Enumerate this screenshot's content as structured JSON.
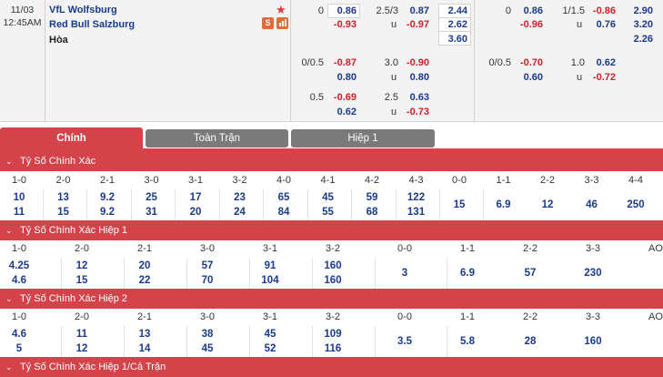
{
  "match": {
    "date": "11/03",
    "time": "12:45AM",
    "home_team": "VfL Wolfsburg",
    "away_team": "Red Bull Salzburg",
    "draw_label": "Hòa",
    "badge_s": "S"
  },
  "odds": {
    "block1": {
      "r1": {
        "hc": "0",
        "v1": "0.86",
        "ou": "2.5/3",
        "v2": "0.87",
        "x12": "2.44"
      },
      "r2": {
        "v1": "-0.93",
        "u": "u",
        "v2": "-0.97",
        "x12": "2.62"
      },
      "r3": {
        "x12": "3.60"
      }
    },
    "block2": {
      "r1": {
        "hc": "0/0.5",
        "v1": "-0.87",
        "ou": "3.0",
        "v2": "-0.90"
      },
      "r2": {
        "v1": "0.80",
        "u": "u",
        "v2": "0.80"
      }
    },
    "block3": {
      "r1": {
        "hc": "0.5",
        "v1": "-0.69",
        "ou": "2.5",
        "v2": "0.63"
      },
      "r2": {
        "v1": "0.62",
        "u": "u",
        "v2": "-0.73"
      }
    },
    "half1": {
      "r1": {
        "hc": "0",
        "v1": "0.86",
        "ou": "1/1.5",
        "v2": "-0.86",
        "x12": "2.90"
      },
      "r2": {
        "v1": "-0.96",
        "u": "u",
        "v2": "0.76",
        "x12": "3.20"
      },
      "r3": {
        "x12": "2.26"
      }
    },
    "half2": {
      "r1": {
        "hc": "0/0.5",
        "v1": "-0.70",
        "ou": "1.0",
        "v2": "0.62"
      },
      "r2": {
        "v1": "0.60",
        "u": "u",
        "v2": "-0.72"
      }
    }
  },
  "tabs": {
    "main": "Chính",
    "full": "Toàn Trận",
    "half": "Hiệp 1"
  },
  "sections": {
    "s1": {
      "title": "Tỷ Số Chính Xác",
      "headers": [
        "1-0",
        "2-0",
        "2-1",
        "3-0",
        "3-1",
        "3-2",
        "4-0",
        "4-1",
        "4-2",
        "4-3",
        "0-0",
        "1-1",
        "2-2",
        "3-3",
        "4-4"
      ],
      "home": [
        "10",
        "13",
        "9.2",
        "25",
        "17",
        "23",
        "65",
        "45",
        "59",
        "122"
      ],
      "away": [
        "11",
        "15",
        "9.2",
        "31",
        "20",
        "24",
        "84",
        "55",
        "68",
        "131"
      ],
      "draw": [
        "15",
        "6.9",
        "12",
        "46",
        "250"
      ]
    },
    "s2": {
      "title": "Tỷ Số Chính Xác Hiệp 1",
      "headers": [
        "1-0",
        "2-0",
        "2-1",
        "3-0",
        "3-1",
        "3-2",
        "0-0",
        "1-1",
        "2-2",
        "3-3",
        "AO"
      ],
      "home": [
        "4.25",
        "12",
        "20",
        "57",
        "91",
        "160"
      ],
      "away": [
        "4.6",
        "15",
        "22",
        "70",
        "104",
        "160"
      ],
      "draw": [
        "3",
        "6.9",
        "57",
        "230"
      ]
    },
    "s3": {
      "title": "Tỷ Số Chính Xác Hiệp 2",
      "headers": [
        "1-0",
        "2-0",
        "2-1",
        "3-0",
        "3-1",
        "3-2",
        "0-0",
        "1-1",
        "2-2",
        "3-3",
        "AO"
      ],
      "home": [
        "4.6",
        "11",
        "13",
        "38",
        "45",
        "109"
      ],
      "away": [
        "5",
        "12",
        "14",
        "45",
        "52",
        "116"
      ],
      "draw": [
        "3.5",
        "5.8",
        "28",
        "160"
      ]
    },
    "s4": {
      "title": "Tỷ Số Chính Xác Hiệp 1/Cả Trận"
    }
  },
  "colors": {
    "accent": "#d5434a",
    "blue": "#1a3a8c",
    "red": "#d0202a"
  }
}
